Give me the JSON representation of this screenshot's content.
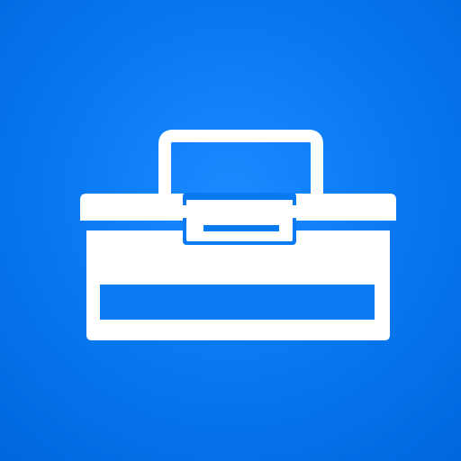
{
  "app_icon": {
    "icon": "toolbox-icon",
    "colors": {
      "background": "#0a7af2",
      "glyph": "#ffffff"
    }
  }
}
